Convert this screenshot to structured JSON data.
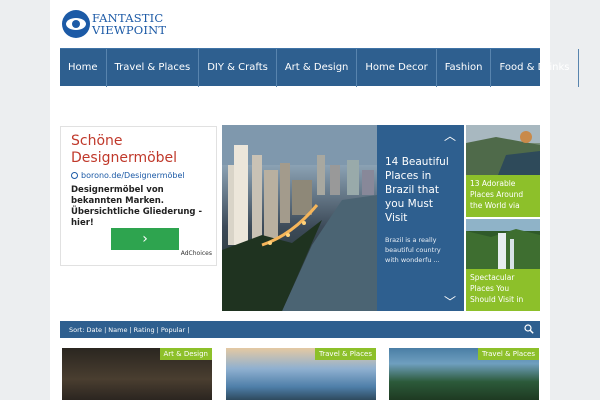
{
  "brand": {
    "line1": "FANTASTIC",
    "line2": "VIEWPOINT"
  },
  "nav": {
    "items": [
      "Home",
      "Travel & Places",
      "DIY & Crafts",
      "Art & Design",
      "Home Decor",
      "Fashion",
      "Food & Drinks"
    ]
  },
  "ad": {
    "title": "Schöne Designermöbel",
    "link": "borono.de/Designermöbel",
    "body": "Designermöbel von bekannten Marken. Übersichtliche Gliederung -hier!",
    "button": "›",
    "choices": "AdChoices"
  },
  "slider": {
    "title": "14 Beautiful Places in Brazil that you Must Visit",
    "description": "Brazil is a really beautiful country with wonderfu ...",
    "thumbs": [
      {
        "caption": "13 Adorable Places Around the World via"
      },
      {
        "caption": "Spectacular Places You Should Visit in"
      }
    ]
  },
  "sort": {
    "label": "Sort:",
    "options": [
      "Date",
      "Name",
      "Rating",
      "Popular"
    ]
  },
  "cards": [
    {
      "tag": "Art & Design"
    },
    {
      "tag": "Travel & Places"
    },
    {
      "tag": "Travel & Places"
    }
  ],
  "colors": {
    "nav": "#2e5f8f",
    "accent": "#8dc02a",
    "ad_title": "#c0392b",
    "ad_button": "#2ea44f"
  }
}
